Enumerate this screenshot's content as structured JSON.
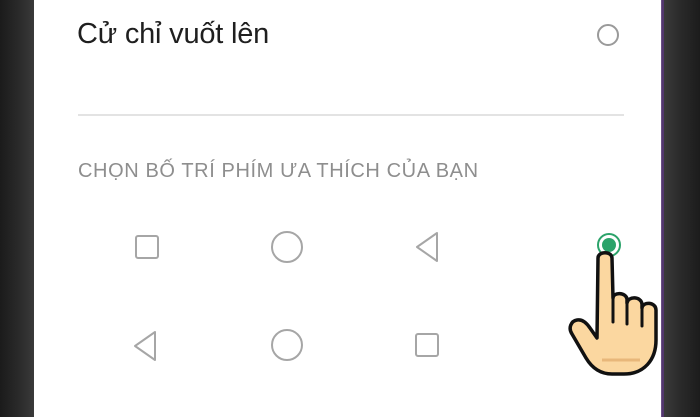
{
  "settings": {
    "gesture_option": {
      "label": "Cử chỉ vuốt lên",
      "selected": false
    },
    "layout_section": {
      "header": "CHỌN BỐ TRÍ PHÍM ƯA THÍCH CỦA BẠN",
      "layouts": [
        {
          "icons": [
            "square-icon",
            "circle-icon",
            "back-triangle-icon"
          ],
          "selected": true
        },
        {
          "icons": [
            "back-triangle-icon",
            "circle-icon",
            "square-icon"
          ],
          "selected": false
        }
      ]
    }
  },
  "colors": {
    "accent": "#2ba36a",
    "icon_gray": "#a6a6a6",
    "header_gray": "#8e8e8e",
    "text": "#1f1f1f",
    "hand_fill": "#fbd7a0"
  },
  "overlay": {
    "cursor_icon": "pointing-hand-icon"
  }
}
